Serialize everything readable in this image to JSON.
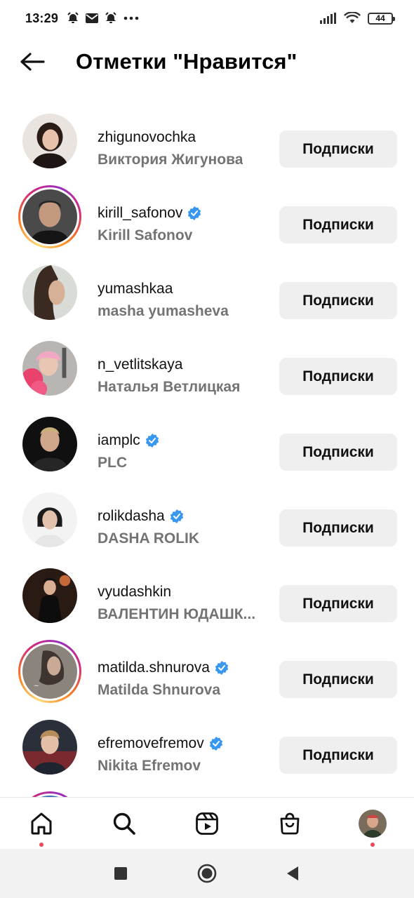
{
  "status_bar": {
    "time": "13:29",
    "battery": "44",
    "icons": [
      "alarm-icon",
      "mail-icon",
      "alarm-icon",
      "more-dots-icon",
      "signal-icon",
      "wifi-icon",
      "battery-icon"
    ]
  },
  "header": {
    "title": "Отметки \"Нравится\"",
    "back_icon": "arrow-left-icon"
  },
  "list": {
    "users": [
      {
        "username": "zhigunovochka",
        "full_name": "Виктория Жигунова",
        "verified": false,
        "story_ring": false,
        "button": "Подписки"
      },
      {
        "username": "kirill_safonov",
        "full_name": "Kirill Safonov",
        "verified": true,
        "story_ring": true,
        "button": "Подписки"
      },
      {
        "username": "yumashkaa",
        "full_name": "masha yumasheva",
        "verified": false,
        "story_ring": false,
        "button": "Подписки"
      },
      {
        "username": "n_vetlitskaya",
        "full_name": "Наталья Ветлицкая",
        "verified": false,
        "story_ring": false,
        "button": "Подписки"
      },
      {
        "username": "iamplc",
        "full_name": "PLC",
        "verified": true,
        "story_ring": false,
        "button": "Подписки"
      },
      {
        "username": "rolikdasha",
        "full_name": "DASHA ROLIK",
        "verified": true,
        "story_ring": false,
        "button": "Подписки"
      },
      {
        "username": "vyudashkin",
        "full_name": "ВАЛЕНТИН ЮДАШК...",
        "verified": false,
        "story_ring": false,
        "button": "Подписки"
      },
      {
        "username": "matilda.shnurova",
        "full_name": "Matilda Shnurova",
        "verified": true,
        "story_ring": true,
        "button": "Подписки"
      },
      {
        "username": "efremovefremov",
        "full_name": "Nikita Efremov",
        "verified": true,
        "story_ring": false,
        "button": "Подписки"
      }
    ]
  },
  "bottom_nav": {
    "items": [
      "home-icon",
      "search-icon",
      "reels-icon",
      "shop-icon",
      "profile-avatar"
    ]
  },
  "colors": {
    "verified_blue": "#3897f0",
    "button_bg": "#efefef",
    "secondary_text": "#737373",
    "notification_dot": "#ed4956"
  }
}
